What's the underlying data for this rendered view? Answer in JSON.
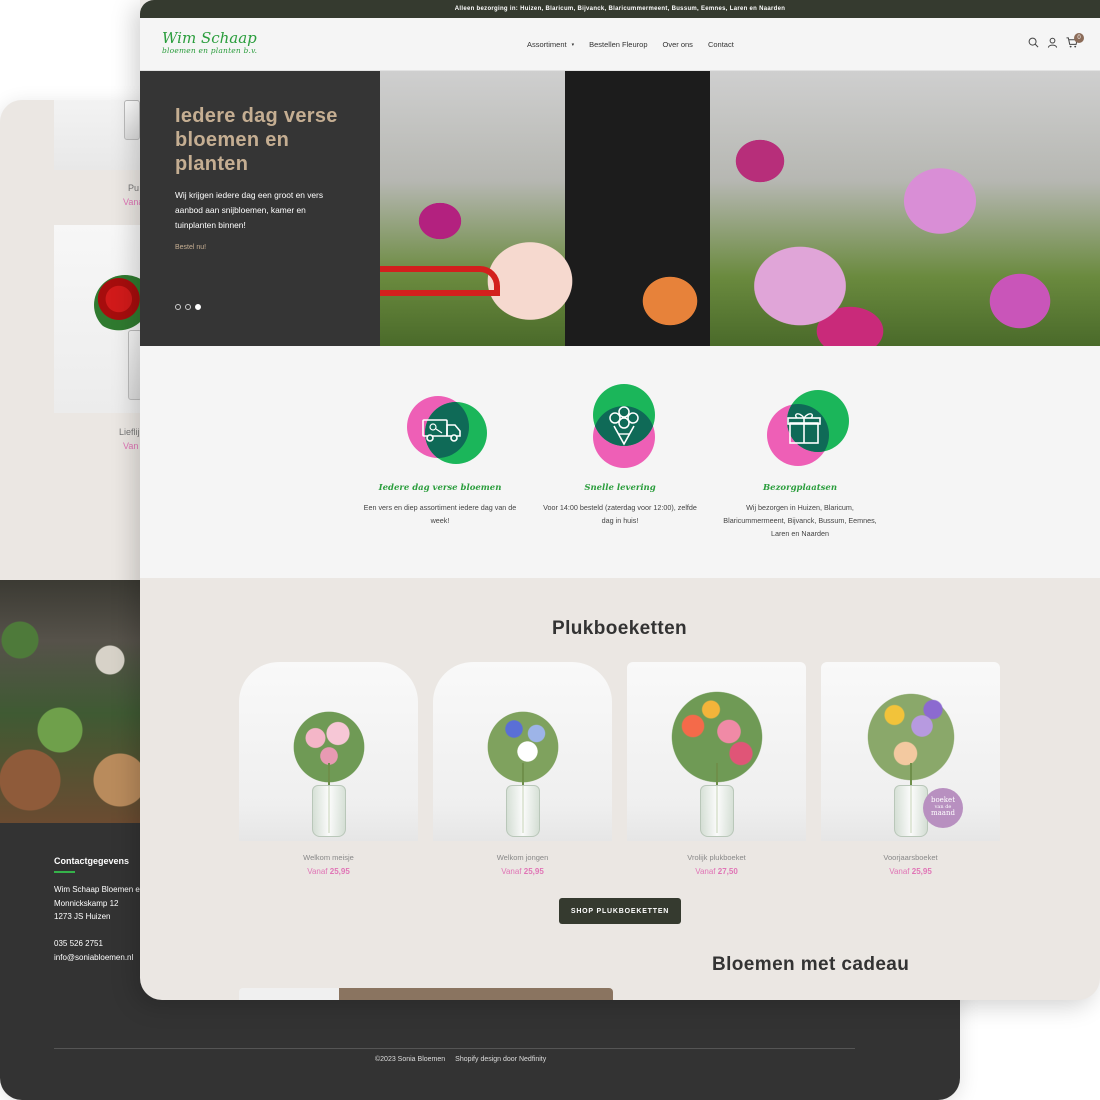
{
  "back_window": {
    "products": [
      {
        "name": "Pu",
        "price": "Vana"
      },
      {
        "name": "Lieflijk",
        "price": "Van"
      }
    ],
    "contact": {
      "title": "Contactgegevens",
      "company": "Wim Schaap Bloemen en",
      "street": "Monnickskamp 12",
      "postal": "1273 JS Huizen",
      "phone": "035 526 2751",
      "email": "info@soniabloemen.nl"
    },
    "copyright": "©2023 Sonia Bloemen",
    "credits": "Shopify design door Nedfinity"
  },
  "announcement": "Alleen bezorging in: Huizen, Blaricum, Bijvanck, Blaricummermeent, Bussum, Eemnes, Laren en Naarden",
  "logo": {
    "line1": "Wim Schaap",
    "line2": "bloemen en planten b.v."
  },
  "nav": {
    "items": [
      "Assortiment",
      "Bestellen Fleurop",
      "Over ons",
      "Contact"
    ],
    "caret": "▾"
  },
  "cart": {
    "count": "0"
  },
  "icons": [
    "search-icon",
    "account-icon",
    "cart-icon"
  ],
  "hero": {
    "title": "Iedere dag verse bloemen en planten",
    "text": "Wij krijgen iedere dag een groot en vers aanbod aan snijbloemen, kamer en tuinplanten binnen!",
    "cta": "Bestel nu!",
    "slide_count": 3,
    "active_slide": 3
  },
  "features": [
    {
      "icon": "delivery-truck-icon",
      "title": "Iedere dag verse bloemen",
      "text": "Een vers en diep assortiment iedere dag van de week!"
    },
    {
      "icon": "bouquet-icon",
      "title": "Snelle levering",
      "text": "Voor 14:00 besteld (zaterdag voor 12:00), zelfde dag in huis!"
    },
    {
      "icon": "gift-icon",
      "title": "Bezorgplaatsen",
      "text": "Wij bezorgen in Huizen, Blaricum, Blaricummermeent, Bijvanck, Bussum, Eemnes, Laren en Naarden"
    }
  ],
  "plukboeketten": {
    "title": "Plukboeketten",
    "products": [
      {
        "name": "Welkom meisje",
        "price_label": "Vanaf",
        "price": "25,95"
      },
      {
        "name": "Welkom jongen",
        "price_label": "Vanaf",
        "price": "25,95"
      },
      {
        "name": "Vrolijk plukboeket",
        "price_label": "Vanaf",
        "price": "27,50"
      },
      {
        "name": "Voorjaarsboeket",
        "price_label": "Vanaf",
        "price": "25,95",
        "badge": {
          "line1": "boeket",
          "line2": "van de",
          "line3": "maand"
        }
      }
    ],
    "button": "SHOP PLUKBOEKETTEN"
  },
  "cadeau": {
    "title": "Bloemen met cadeau"
  },
  "colors": {
    "brand_green": "#2a9d3c",
    "accent_pink": "#ee5fb6",
    "accent_tan": "#c5ae92",
    "dark": "#353535",
    "price_pink": "#e075b6"
  }
}
